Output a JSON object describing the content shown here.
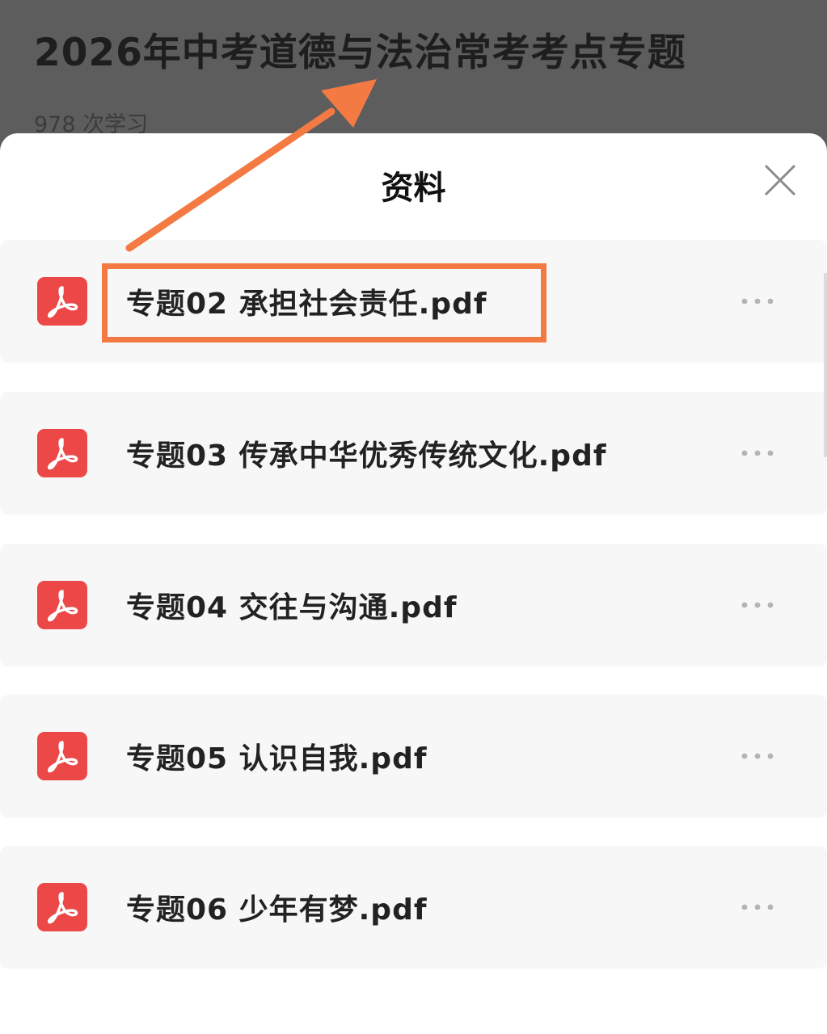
{
  "background_page": {
    "title": "2026年中考道德与法治常考考点专题",
    "study_count": "978 次学习"
  },
  "sheet": {
    "title": "资料",
    "close_icon": "close-icon"
  },
  "files": [
    {
      "name": "专题02 承担社会责任.pdf",
      "icon": "pdf-icon",
      "more_icon": "more-dots-icon",
      "highlighted": true
    },
    {
      "name": "专题03 传承中华优秀传统文化.pdf",
      "icon": "pdf-icon",
      "more_icon": "more-dots-icon",
      "highlighted": false
    },
    {
      "name": "专题04 交往与沟通.pdf",
      "icon": "pdf-icon",
      "more_icon": "more-dots-icon",
      "highlighted": false
    },
    {
      "name": "专题05 认识自我.pdf",
      "icon": "pdf-icon",
      "more_icon": "more-dots-icon",
      "highlighted": false
    },
    {
      "name": "专题06 少年有梦.pdf",
      "icon": "pdf-icon",
      "more_icon": "more-dots-icon",
      "highlighted": false
    }
  ],
  "colors": {
    "pdf_icon": "#ec4848",
    "annotation": "#f37a42",
    "row_background": "#f7f7f7",
    "overlay": "#5d5d5d"
  }
}
